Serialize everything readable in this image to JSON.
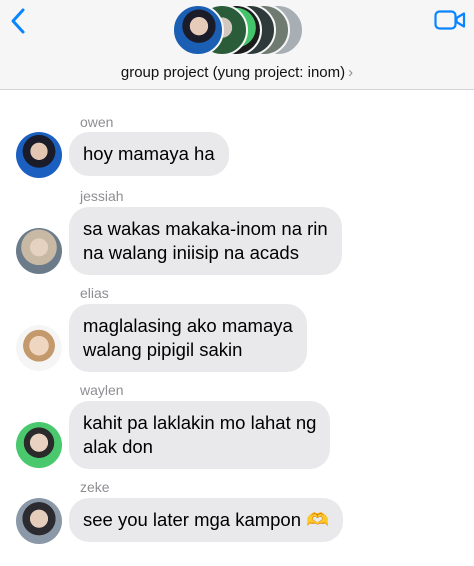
{
  "header": {
    "group_name": "group project (yung project: inom)",
    "chevron": "›",
    "back_icon": "chevron-left-icon",
    "video_icon": "video-camera-icon",
    "accent_color": "#0a84ff"
  },
  "messages": [
    {
      "sender": "owen",
      "lines": [
        "hoy mamaya ha"
      ]
    },
    {
      "sender": "jessiah",
      "lines": [
        "sa wakas makaka-inom na rin",
        "na walang iniisip na acads"
      ]
    },
    {
      "sender": "elias",
      "lines": [
        "maglalasing ako mamaya",
        "walang pipigil sakin"
      ]
    },
    {
      "sender": "waylen",
      "lines": [
        "kahit pa laklakin mo lahat ng",
        "alak don"
      ]
    },
    {
      "sender": "zeke",
      "lines": [
        "see you later mga kampon 🫶"
      ]
    }
  ],
  "colors": {
    "bubble": "#e9e9eb",
    "sender_label": "#8e8e93",
    "header_bg": "#f6f6f6"
  }
}
